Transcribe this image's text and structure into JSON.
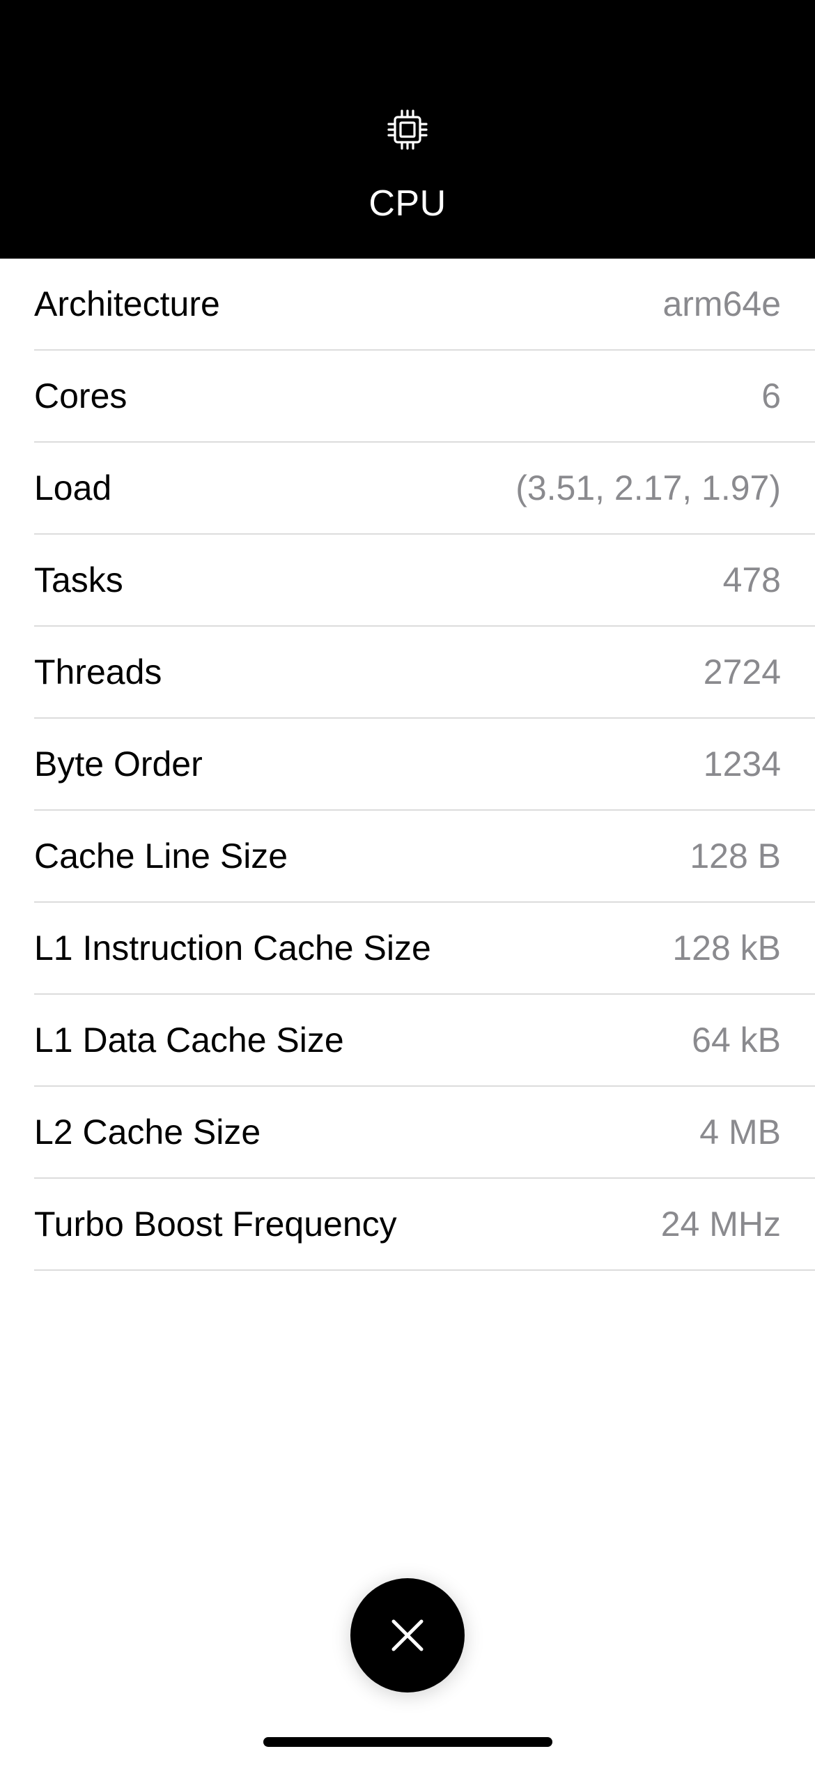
{
  "header": {
    "icon": "cpu-chip-icon",
    "title": "CPU"
  },
  "rows": [
    {
      "label": "Architecture",
      "value": "arm64e"
    },
    {
      "label": "Cores",
      "value": "6"
    },
    {
      "label": "Load",
      "value": "(3.51, 2.17, 1.97)"
    },
    {
      "label": "Tasks",
      "value": "478"
    },
    {
      "label": "Threads",
      "value": "2724"
    },
    {
      "label": "Byte Order",
      "value": "1234"
    },
    {
      "label": "Cache Line Size",
      "value": "128 B"
    },
    {
      "label": "L1 Instruction Cache Size",
      "value": "128 kB"
    },
    {
      "label": "L1 Data Cache Size",
      "value": "64 kB"
    },
    {
      "label": "L2 Cache Size",
      "value": "4 MB"
    },
    {
      "label": "Turbo Boost Frequency",
      "value": "24 MHz"
    }
  ],
  "close_button": {
    "icon": "close-icon"
  },
  "colors": {
    "header_background": "#000000",
    "value_text": "#8a8a8e",
    "separator": "#dcdcdc"
  }
}
